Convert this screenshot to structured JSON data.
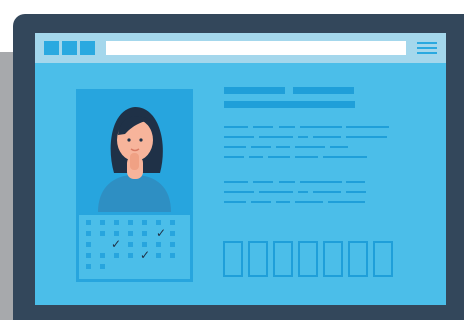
{
  "illustration": {
    "type": "profile-browser-window",
    "icons": {
      "tabs": "browser-tab-icon",
      "menu": "hamburger-menu-icon",
      "avatar": "woman-avatar-icon",
      "calendar": "calendar-icon",
      "check": "check-icon"
    },
    "colors": {
      "frame": "#33475b",
      "screen": "#4bbee9",
      "topbar": "#a4d7ec",
      "panel": "#27a5de",
      "accent": "#1f9fd9",
      "skin": "#f7b49b",
      "hair": "#1f3147",
      "shirt": "#2e8fc3",
      "gray": "#a7a9ac"
    },
    "calendar": {
      "checks": [
        "✓",
        "✓",
        "✓"
      ]
    }
  }
}
